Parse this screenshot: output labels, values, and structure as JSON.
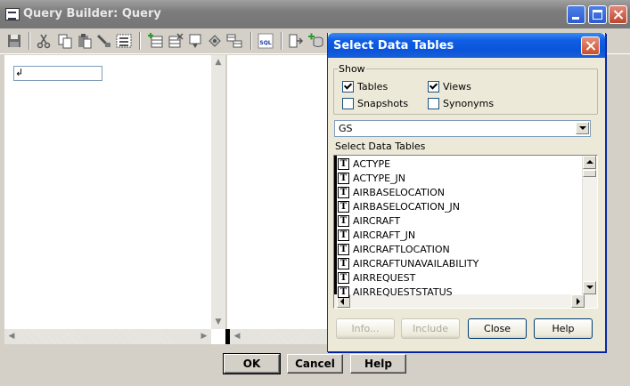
{
  "window": {
    "title": "Query Builder: Query",
    "icon": "query-builder-app-icon"
  },
  "toolbar": {
    "buttons": [
      "save-icon",
      "cut-icon",
      "copy-icon",
      "paste-icon",
      "clear-icon",
      "select-all-icon",
      "add-table-icon",
      "delete-table-icon",
      "filter-icon",
      "edit-icon",
      "group-icon",
      "sql-icon",
      "import-icon",
      "add-database-icon"
    ],
    "sql_label": "SQL"
  },
  "editor": {
    "cursor_glyph": "↲"
  },
  "buttons": {
    "ok": "OK",
    "cancel": "Cancel",
    "help": "Help"
  },
  "dialog": {
    "title": "Select Data Tables",
    "show_group": "Show",
    "checkboxes": {
      "tables": {
        "label": "Tables",
        "checked": true
      },
      "views": {
        "label": "Views",
        "checked": true
      },
      "snapshots": {
        "label": "Snapshots",
        "checked": false
      },
      "synonyms": {
        "label": "Synonyms",
        "checked": false
      }
    },
    "schema_value": "GS",
    "list_label": "Select Data Tables",
    "table_icon_glyph": "T",
    "tables": [
      "ACTYPE",
      "ACTYPE_JN",
      "AIRBASELOCATION",
      "AIRBASELOCATION_JN",
      "AIRCRAFT",
      "AIRCRAFT_JN",
      "AIRCRAFTLOCATION",
      "AIRCRAFTUNAVAILABILITY",
      "AIRREQUEST",
      "AIRREQUESTSTATUS"
    ],
    "buttons": {
      "info": {
        "label": "Info...",
        "enabled": false
      },
      "include": {
        "label": "Include",
        "enabled": false
      },
      "close": {
        "label": "Close",
        "enabled": true
      },
      "help": {
        "label": "Help",
        "enabled": true
      }
    }
  },
  "colors": {
    "dialog_title": "#0a55da",
    "main_title_inactive": "#7c7c7c",
    "surface": "#d4d0c8"
  }
}
